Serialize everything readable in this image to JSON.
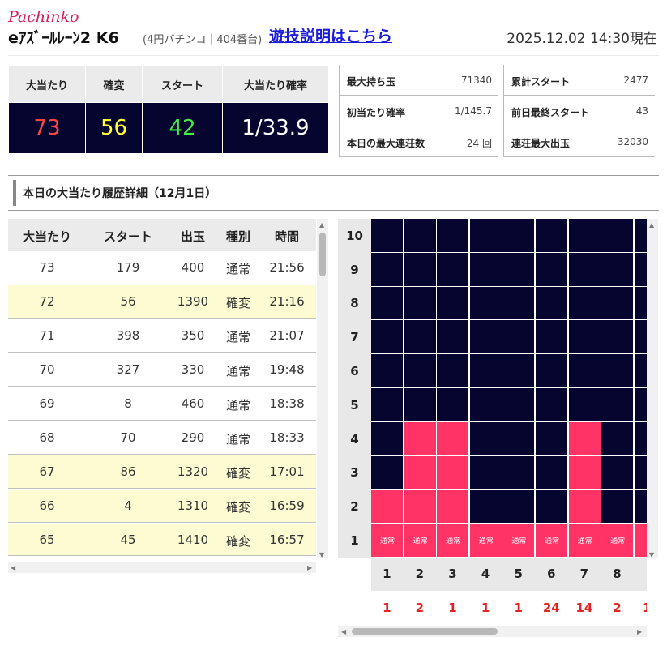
{
  "header": {
    "brand": "Pachinko",
    "machine_name": "eｱｽﾞｰﾙﾚｰﾝ2 K6",
    "machine_sub": "(4円パチンコ｜404番台)",
    "guide_link": "遊技説明はこちら",
    "timestamp": "2025.12.02 14:30現在"
  },
  "summary": {
    "headers": [
      "大当たり",
      "確変",
      "スタート",
      "大当たり確率"
    ],
    "values": [
      "73",
      "56",
      "42",
      "1/33.9"
    ],
    "colors": [
      "#ff4444",
      "#ffff33",
      "#44ee44",
      "#ffffff"
    ]
  },
  "stats": [
    {
      "label": "最大持ち玉",
      "value": "71340"
    },
    {
      "label": "初当たり確率",
      "value": "1/145.7"
    },
    {
      "label": "本日の最大連荘数",
      "value": "24 回"
    },
    {
      "label": "累計スタート",
      "value": "2477"
    },
    {
      "label": "前日最終スタート",
      "value": "43"
    },
    {
      "label": "連荘最大出玉",
      "value": "32030"
    }
  ],
  "history": {
    "title": "本日の大当たり履歴詳細（12月1日）",
    "columns": [
      "大当たり",
      "スタート",
      "出玉",
      "種別",
      "時間"
    ],
    "rows": [
      {
        "hit": "73",
        "start": "179",
        "payout": "400",
        "type": "通常",
        "time": "21:56"
      },
      {
        "hit": "72",
        "start": "56",
        "payout": "1390",
        "type": "確変",
        "time": "21:16"
      },
      {
        "hit": "71",
        "start": "398",
        "payout": "350",
        "type": "通常",
        "time": "21:07"
      },
      {
        "hit": "70",
        "start": "327",
        "payout": "330",
        "type": "通常",
        "time": "19:48"
      },
      {
        "hit": "69",
        "start": "8",
        "payout": "460",
        "type": "通常",
        "time": "18:38"
      },
      {
        "hit": "68",
        "start": "70",
        "payout": "290",
        "type": "通常",
        "time": "18:33"
      },
      {
        "hit": "67",
        "start": "86",
        "payout": "1320",
        "type": "確変",
        "time": "17:01"
      },
      {
        "hit": "66",
        "start": "4",
        "payout": "1310",
        "type": "確変",
        "time": "16:59"
      },
      {
        "hit": "65",
        "start": "45",
        "payout": "1410",
        "type": "確変",
        "time": "16:57"
      }
    ]
  },
  "graph": {
    "y_labels": [
      "10",
      "9",
      "8",
      "7",
      "6",
      "5",
      "4",
      "3",
      "2",
      "1"
    ],
    "columns": [
      {
        "index": "1",
        "type": "通常",
        "count": "1",
        "fill": 2
      },
      {
        "index": "2",
        "type": "通常",
        "count": "2",
        "fill": 4
      },
      {
        "index": "3",
        "type": "通常",
        "count": "1",
        "fill": 4
      },
      {
        "index": "4",
        "type": "通常",
        "count": "1",
        "fill": 1
      },
      {
        "index": "5",
        "type": "通常",
        "count": "1",
        "fill": 1
      },
      {
        "index": "6",
        "type": "通常",
        "count": "24",
        "fill": 1
      },
      {
        "index": "7",
        "type": "通常",
        "count": "14",
        "fill": 4
      },
      {
        "index": "8",
        "type": "通常",
        "count": "2",
        "fill": 1
      },
      {
        "index": "",
        "type": "通",
        "count": "1",
        "fill": 1
      }
    ],
    "colors": {
      "empty": "#05052f",
      "filled": "#ff3366"
    }
  }
}
